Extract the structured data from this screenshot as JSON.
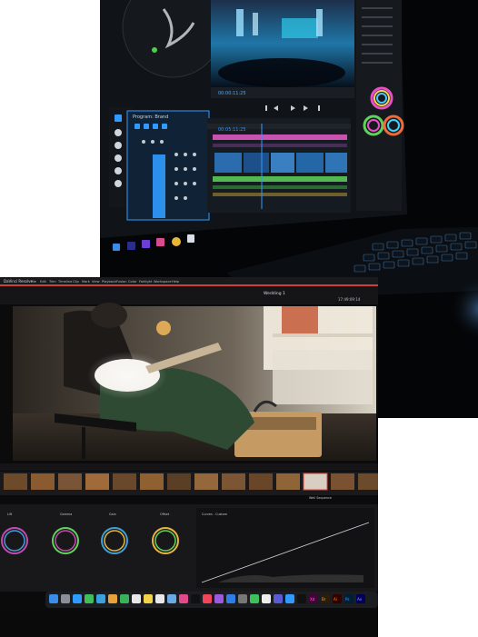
{
  "top_photo": {
    "timecode_preview": "00:00:11:25",
    "timeline_timecode": "00:05:11:25",
    "program_tab": "Program: Brand"
  },
  "bottom_photo": {
    "app_title": "DaVinci Resolve",
    "project_name": "Wedding 1",
    "menu_items": [
      "File",
      "Edit",
      "Trim",
      "Timeline",
      "Clip",
      "Mark",
      "View",
      "Playback",
      "Fusion",
      "Color",
      "Fairlight",
      "Workspace",
      "Help"
    ],
    "timecode": "17:49:09:14",
    "clip_label": "Well Sequence",
    "color_wheels": [
      "Lift",
      "Gamma",
      "Gain",
      "Offset"
    ],
    "curves_label": "Curves - Custom",
    "dock_ai": "Ai",
    "dock_ps": "Ps",
    "dock_ae": "Ae",
    "dock_xd": "Xd",
    "dock_br": "Br"
  },
  "colors": {
    "accent_blue": "#2f9bff",
    "accent_pink": "#e85cc9",
    "accent_green": "#5fd35a",
    "resolve_red": "#e2473b"
  }
}
